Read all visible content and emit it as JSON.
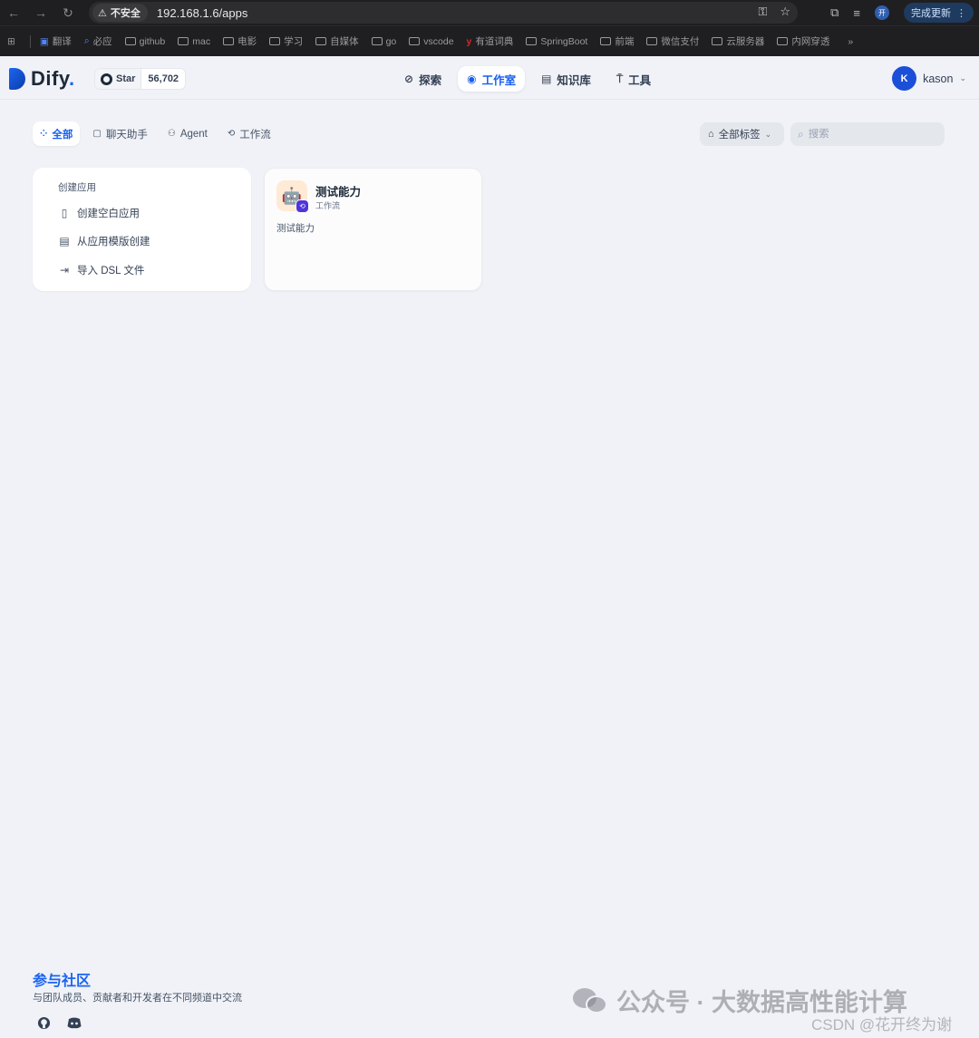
{
  "browser": {
    "insecure_label": "不安全",
    "url": "192.168.1.6/apps",
    "profile_initial": "开",
    "update_label": "完成更新",
    "bookmarks": [
      "翻译",
      "必应",
      "github",
      "mac",
      "电影",
      "学习",
      "自媒体",
      "go",
      "vscode",
      "有道词典",
      "SpringBoot",
      "前端",
      "微信支付",
      "云服务器",
      "内网穿透"
    ]
  },
  "header": {
    "logo_text": "Dify",
    "logo_dot": ".",
    "github_star_label": "Star",
    "github_star_count": "56,702",
    "nav": [
      {
        "label": "探索",
        "icon": "compass-icon"
      },
      {
        "label": "工作室",
        "icon": "robot-icon"
      },
      {
        "label": "知识库",
        "icon": "book-icon"
      },
      {
        "label": "工具",
        "icon": "hammer-icon"
      }
    ],
    "active_nav": "工作室",
    "user_initial": "K",
    "user_name": "kason"
  },
  "filters": {
    "tabs": [
      "全部",
      "聊天助手",
      "Agent",
      "工作流"
    ],
    "active_tab": "全部",
    "tag_filter_label": "全部标签",
    "search_placeholder": "搜索"
  },
  "create_card": {
    "title": "创建应用",
    "items": [
      "创建空白应用",
      "从应用模版创建",
      "导入 DSL 文件"
    ]
  },
  "apps": [
    {
      "name": "测试能力",
      "type": "工作流",
      "description": "测试能力"
    }
  ],
  "footer": {
    "community_title": "参与社区",
    "community_desc": "与团队成员、贡献者和开发者在不同频道中交流"
  },
  "watermark": {
    "text": "公众号 · 大数据高性能计算",
    "csdn": "CSDN @花开终为谢"
  },
  "colors": {
    "accent": "#155eef",
    "page_bg": "#f0f2f7",
    "avatar_bg": "#1c4fd8",
    "app_icon_bg": "#ffead5",
    "workflow_badge": "#4e36d9"
  }
}
